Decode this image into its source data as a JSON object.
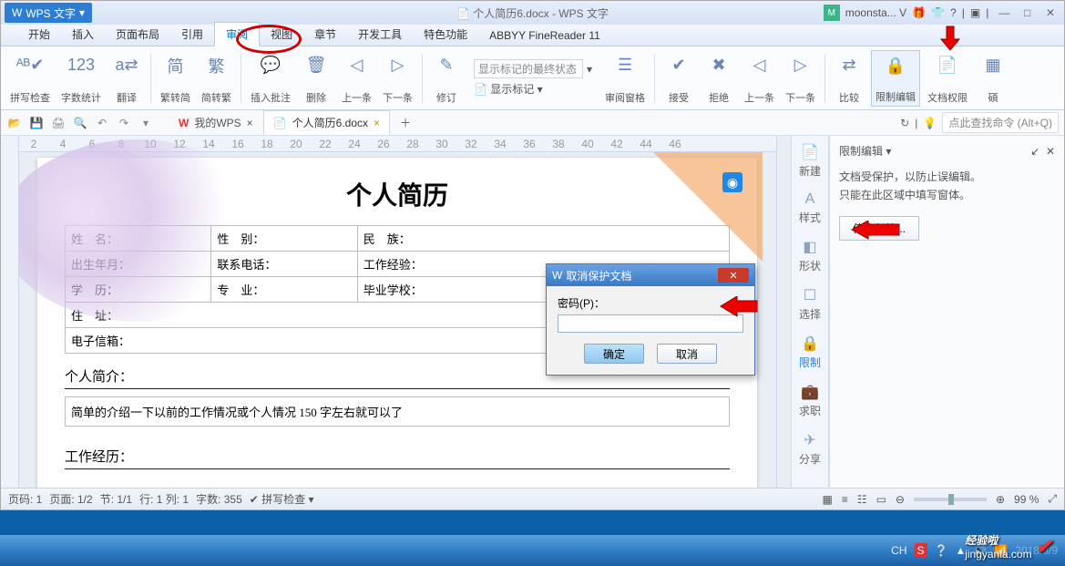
{
  "app": {
    "name": "WPS 文字",
    "title_center": "个人简历6.docx - WPS 文字",
    "user": "moonsta... V"
  },
  "menus": [
    "开始",
    "插入",
    "页面布局",
    "引用",
    "审阅",
    "视图",
    "章节",
    "开发工具",
    "特色功能",
    "ABBYY FineReader 11"
  ],
  "active_menu_index": 4,
  "ribbon": {
    "spellcheck": "拼写检查",
    "wordcount": "字数统计",
    "translate": "翻译",
    "scconv": "繁转简",
    "tcconv": "简转繁",
    "insertcomment": "插入批注",
    "delete": "删除",
    "prev": "上一条",
    "next": "下一条",
    "revise": "修订",
    "trackstate": "显示标记的最终状态",
    "showmarkup": "显示标记",
    "reviewpane": "审阅窗格",
    "accept": "接受",
    "reject": "拒绝",
    "prev2": "上一条",
    "next2": "下一条",
    "compare": "比较",
    "restrict": "限制编辑",
    "docperm": "文档权限",
    "hard": "碩"
  },
  "quick": {
    "mywps": "我的WPS",
    "doc": "个人简历6.docx",
    "searchcmd": "点此查找命令 (Alt+Q)"
  },
  "sidebar": {
    "new": "新建",
    "style": "样式",
    "shape": "形状",
    "select": "选择",
    "restrict": "限制",
    "job": "求职",
    "share": "分享"
  },
  "panel": {
    "title": "限制编辑",
    "line1": "文档受保护，以防止误编辑。",
    "line2": "只能在此区域中填写窗体。",
    "stop": "停止保护..."
  },
  "dialog": {
    "title": "取消保护文档",
    "pwd_label": "密码(P)：",
    "ok": "确定",
    "cancel": "取消"
  },
  "doc": {
    "heading": "个人简历",
    "rows": [
      [
        "姓　名：",
        "性　别：",
        "民　族："
      ],
      [
        "出生年月：",
        "联系电话：",
        "工作经验："
      ],
      [
        "学　历：",
        "专　业：",
        "毕业学校："
      ],
      [
        "住　址："
      ],
      [
        "电子信箱："
      ]
    ],
    "sect_intro": "个人简介：",
    "intro_text": "简单的介绍一下以前的工作情况或个人情况 150 字左右就可以了",
    "sect_exp": "工作经历："
  },
  "status": {
    "page": "页码: 1",
    "pages": "页面: 1/2",
    "section": "节: 1/1",
    "line": "行: 1 列: 1",
    "words": "字数: 355",
    "spell": "拼写检查",
    "zoom": "99 %"
  },
  "ruler": [
    "2",
    "4",
    "6",
    "8",
    "10",
    "12",
    "14",
    "16",
    "18",
    "20",
    "22",
    "24",
    "26",
    "28",
    "30",
    "32",
    "34",
    "36",
    "38",
    "40",
    "42",
    "44",
    "46"
  ],
  "tray": {
    "ch": "CH",
    "date": "2018/8/9"
  },
  "watermark": {
    "brand": "经验啦",
    "url": "jingyanla.com"
  }
}
